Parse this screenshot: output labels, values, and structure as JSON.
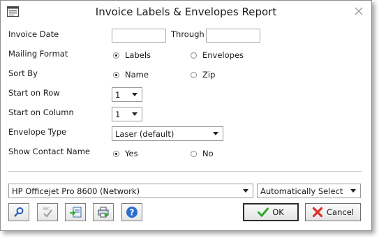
{
  "window": {
    "title": "Invoice Labels & Envelopes Report"
  },
  "form": {
    "invoice_date_label": "Invoice Date",
    "invoice_date_value": "",
    "through_label": "Through",
    "through_value": "",
    "mailing_format_label": "Mailing Format",
    "mailing_format_options": [
      "Labels",
      "Envelopes"
    ],
    "mailing_format_selected": "Labels",
    "sort_by_label": "Sort By",
    "sort_by_options": [
      "Name",
      "Zip"
    ],
    "sort_by_selected": "Name",
    "start_row_label": "Start on Row",
    "start_row_value": "1",
    "start_column_label": "Start on Column",
    "start_column_value": "1",
    "envelope_type_label": "Envelope Type",
    "envelope_type_value": "Laser (default)",
    "show_contact_label": "Show Contact Name",
    "show_contact_options": [
      "Yes",
      "No"
    ],
    "show_contact_selected": "Yes"
  },
  "printer": {
    "printer_value": "HP Officejet Pro 8600 (Network)",
    "tray_value": "Automatically Select"
  },
  "buttons": {
    "ok_label": "OK",
    "cancel_label": "Cancel",
    "toolbar_icons": [
      "magnifier-icon",
      "spellcheck-icon",
      "export-icon",
      "printer-setup-icon",
      "help-icon"
    ]
  },
  "colors": {
    "ok_check": "#2aa52a",
    "cancel_x": "#d9302b",
    "help_blue": "#2a6fd0"
  }
}
